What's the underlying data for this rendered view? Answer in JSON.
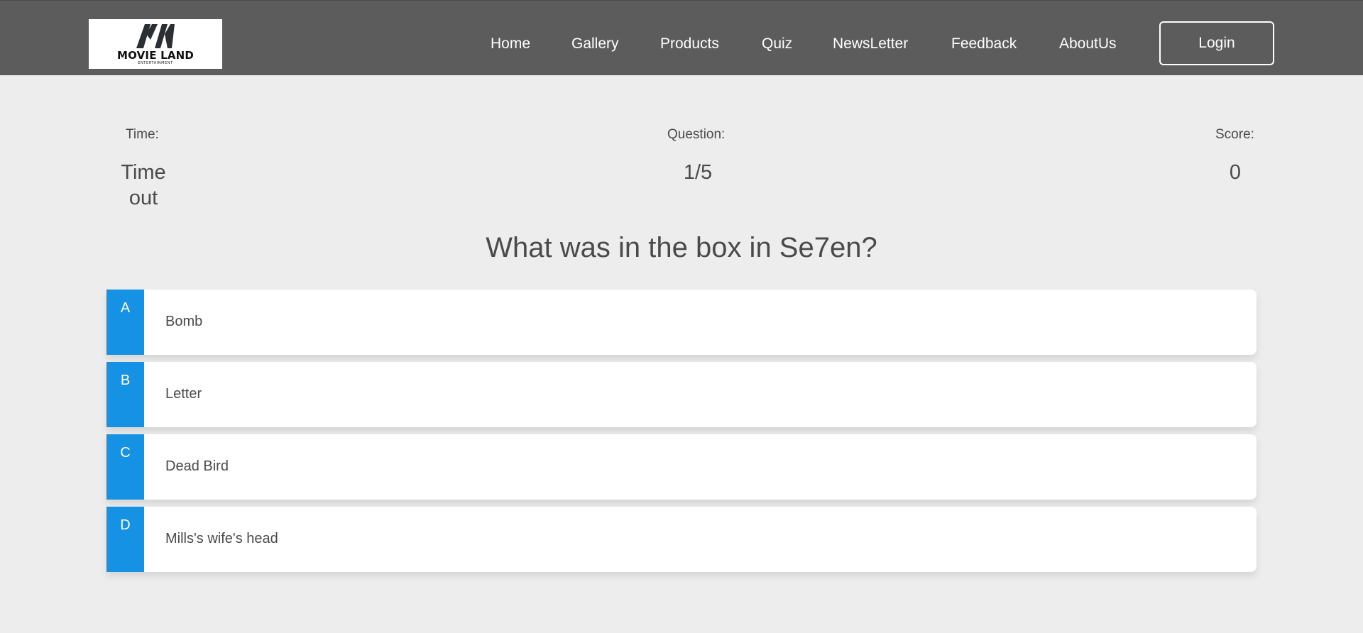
{
  "header": {
    "logo": {
      "title": "MOVIE LAND",
      "subtitle": "ENTERTAINMENT"
    },
    "nav": [
      "Home",
      "Gallery",
      "Products",
      "Quiz",
      "NewsLetter",
      "Feedback",
      "AboutUs"
    ],
    "login_label": "Login",
    "colors": {
      "background": "#5c5c5c",
      "text": "#ffffff"
    }
  },
  "stats": {
    "time_label": "Time:",
    "time_value_line1": "Time",
    "time_value_line2": "out",
    "question_label": "Question:",
    "question_value": "1/5",
    "score_label": "Score:",
    "score_value": "0"
  },
  "quiz": {
    "question": "What was in the box in Se7en?",
    "options": [
      {
        "letter": "A",
        "text": "Bomb"
      },
      {
        "letter": "B",
        "text": "Letter"
      },
      {
        "letter": "C",
        "text": "Dead Bird"
      },
      {
        "letter": "D",
        "text": "Mills's wife's head"
      }
    ],
    "accent_color": "#1592e3"
  }
}
